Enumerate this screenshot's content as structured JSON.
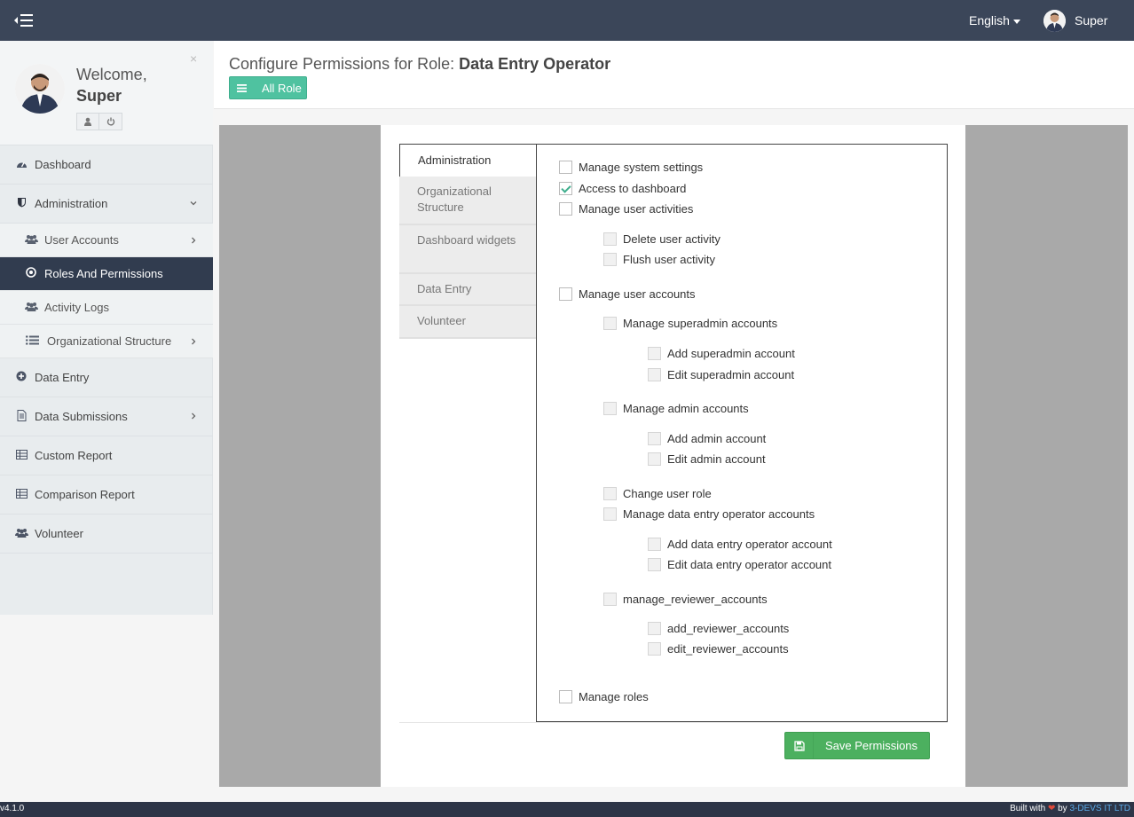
{
  "topbar": {
    "language": "English",
    "user_name": "Super"
  },
  "sidebar": {
    "welcome": "Welcome,",
    "user_name": "Super",
    "close": "×",
    "items": [
      {
        "label": "Dashboard",
        "icon": "dashboard-icon"
      },
      {
        "label": "Administration",
        "icon": "shield-icon"
      },
      {
        "label": "User Accounts",
        "icon": "users-icon"
      },
      {
        "label": "Roles And Permissions",
        "icon": "target-icon"
      },
      {
        "label": "Activity Logs",
        "icon": "users-icon"
      },
      {
        "label": "Organizational Structure",
        "icon": "list-icon"
      },
      {
        "label": "Data Entry",
        "icon": "plus-circle-icon"
      },
      {
        "label": "Data Submissions",
        "icon": "file-icon"
      },
      {
        "label": "Custom Report",
        "icon": "table-icon"
      },
      {
        "label": "Comparison Report",
        "icon": "table-icon"
      },
      {
        "label": "Volunteer",
        "icon": "users-icon"
      }
    ]
  },
  "header": {
    "title_prefix": "Configure Permissions for Role: ",
    "role_name": "Data Entry Operator",
    "all_role_label": "All Role"
  },
  "tabs": [
    {
      "label": "Administration",
      "active": true
    },
    {
      "label": "Organizational Structure",
      "active": false
    },
    {
      "label": "Dashboard widgets",
      "active": false
    },
    {
      "label": "Data Entry",
      "active": false
    },
    {
      "label": "Volunteer",
      "active": false
    }
  ],
  "permissions": [
    {
      "label": "Manage system settings",
      "checked": false,
      "disabled": false
    },
    {
      "label": "Access to dashboard",
      "checked": true,
      "disabled": false
    },
    {
      "label": "Manage user activities",
      "checked": false,
      "disabled": false
    },
    {
      "label": "Delete user activity",
      "checked": false,
      "disabled": true
    },
    {
      "label": "Flush user activity",
      "checked": false,
      "disabled": true
    },
    {
      "label": "Manage user accounts",
      "checked": false,
      "disabled": false
    },
    {
      "label": "Manage superadmin accounts",
      "checked": false,
      "disabled": true
    },
    {
      "label": "Add superadmin account",
      "checked": false,
      "disabled": true
    },
    {
      "label": "Edit superadmin account",
      "checked": false,
      "disabled": true
    },
    {
      "label": "Manage admin accounts",
      "checked": false,
      "disabled": true
    },
    {
      "label": "Add admin account",
      "checked": false,
      "disabled": true
    },
    {
      "label": "Edit admin account",
      "checked": false,
      "disabled": true
    },
    {
      "label": "Change user role",
      "checked": false,
      "disabled": true
    },
    {
      "label": "Manage data entry operator accounts",
      "checked": false,
      "disabled": true
    },
    {
      "label": "Add data entry operator account",
      "checked": false,
      "disabled": true
    },
    {
      "label": "Edit data entry operator account",
      "checked": false,
      "disabled": true
    },
    {
      "label": "manage_reviewer_accounts",
      "checked": false,
      "disabled": true
    },
    {
      "label": "add_reviewer_accounts",
      "checked": false,
      "disabled": true
    },
    {
      "label": "edit_reviewer_accounts",
      "checked": false,
      "disabled": true
    },
    {
      "label": "Manage roles",
      "checked": false,
      "disabled": false
    }
  ],
  "save_label": "Save Permissions",
  "footer": {
    "version": "v4.1.0",
    "built_with": "Built with",
    "by": "by",
    "company": "3-DEVS IT LTD"
  }
}
